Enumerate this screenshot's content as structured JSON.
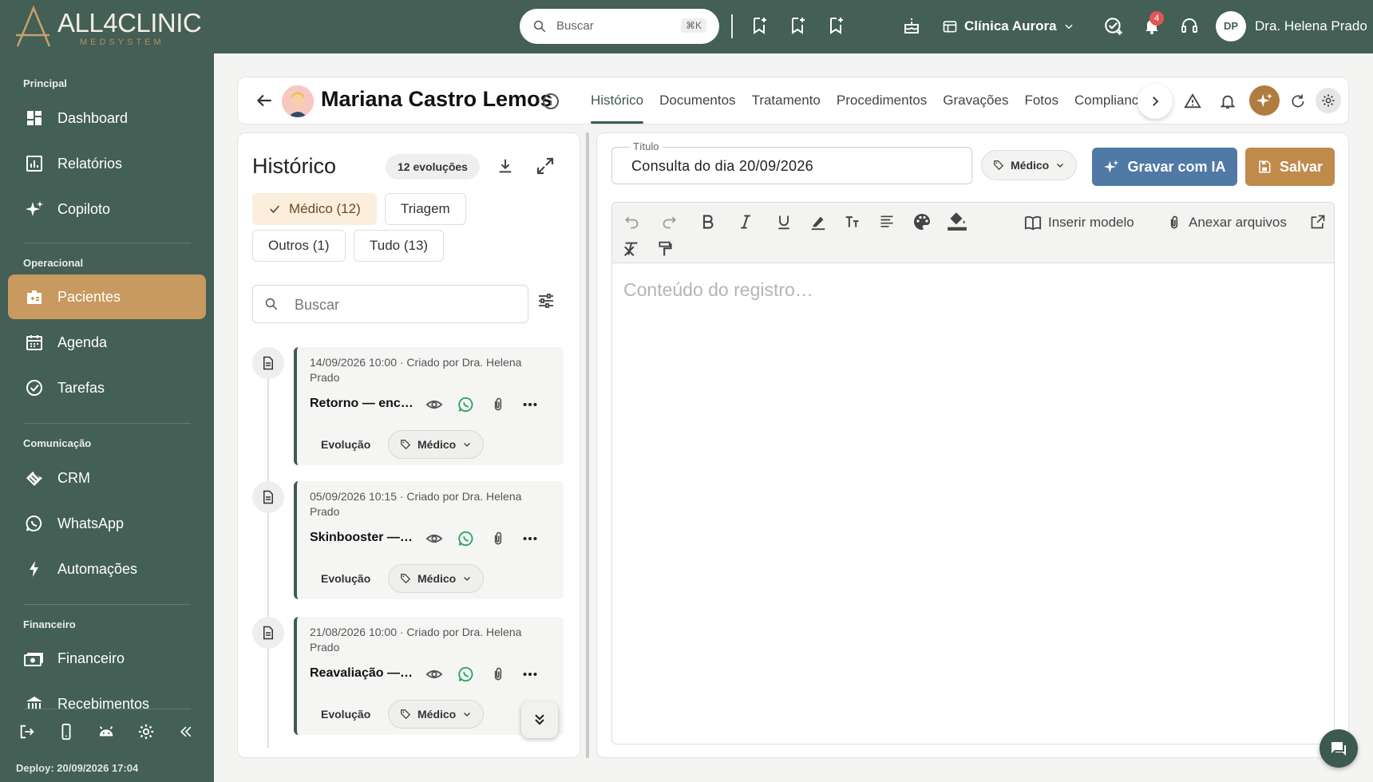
{
  "brand": {
    "name": "ALL4CLINIC",
    "tagline": "MEDSYSTEM"
  },
  "topbar": {
    "search_placeholder": "Buscar",
    "search_shortcut": "⌘K",
    "clinic_name": "Clínica Aurora",
    "notifications_count": "4",
    "user_initials": "DP",
    "user_name": "Dra. Helena Prado"
  },
  "sidebar": {
    "sections": [
      {
        "title": "Principal",
        "items": [
          "Dashboard",
          "Relatórios",
          "Copiloto"
        ]
      },
      {
        "title": "Operacional",
        "items": [
          "Pacientes",
          "Agenda",
          "Tarefas"
        ]
      },
      {
        "title": "Comunicação",
        "items": [
          "CRM",
          "WhatsApp",
          "Automações"
        ]
      },
      {
        "title": "Financeiro",
        "items": [
          "Financeiro",
          "Recebimentos"
        ]
      }
    ],
    "active_item": "Pacientes",
    "deploy": "Deploy: 20/09/2026 17:04"
  },
  "patient": {
    "name": "Mariana Castro Lemos",
    "tabs": [
      "Histórico",
      "Documentos",
      "Tratamento",
      "Procedimentos",
      "Gravações",
      "Fotos",
      "Compliance"
    ],
    "active_tab": "Histórico"
  },
  "history": {
    "title": "Histórico",
    "count_label": "12 evoluções",
    "filters": [
      "Médico (12)",
      "Triagem",
      "Outros (1)",
      "Tudo (13)"
    ],
    "selected_filter": "Médico (12)",
    "search_placeholder": "Buscar",
    "entries": [
      {
        "meta": "14/09/2026 10:00 · Criado por Dra. Helena Prado",
        "title": "Retorno — ence…",
        "type": "Evolução",
        "tag": "Médico"
      },
      {
        "meta": "05/09/2026 10:15 · Criado por Dra. Helena Prado",
        "title": "Skinbooster — f…",
        "type": "Evolução",
        "tag": "Médico"
      },
      {
        "meta": "21/08/2026 10:00 · Criado por Dra. Helena Prado",
        "title": "Reavaliação — r…",
        "type": "Evolução",
        "tag": "Médico"
      }
    ]
  },
  "editor": {
    "title_label": "Título",
    "title_value": "Consulta do dia 20/09/2026",
    "category": "Médico",
    "record_ai_label": "Gravar com IA",
    "save_label": "Salvar",
    "insert_template_label": "Inserir modelo",
    "attach_label": "Anexar arquivos",
    "content_placeholder": "Conteúdo do registro…"
  },
  "colors": {
    "sidebar": "#435f56",
    "accent": "#c89a5f",
    "ai_button": "#5079a6",
    "save_button": "#c08a4b"
  }
}
